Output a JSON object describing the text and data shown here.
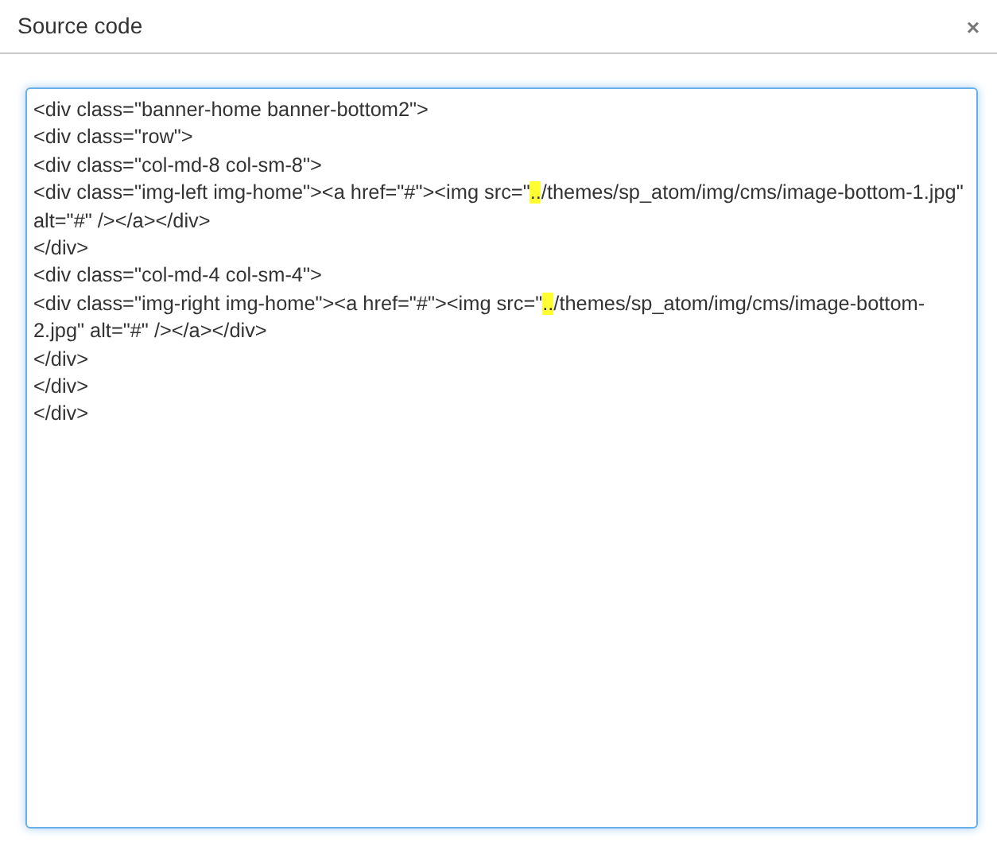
{
  "window": {
    "title": "Source code",
    "close": "×"
  },
  "editor": {
    "lines": [
      [
        {
          "text": "<div class=\"banner-home banner-bottom2\">",
          "highlighted": false
        }
      ],
      [
        {
          "text": "<div class=\"row\">",
          "highlighted": false
        }
      ],
      [
        {
          "text": "<div class=\"col-md-8 col-sm-8\">",
          "highlighted": false
        }
      ],
      [
        {
          "text": "<div class=\"img-left img-home\"><a href=\"#\"><img src=\"",
          "highlighted": false
        },
        {
          "text": "..",
          "highlighted": true
        },
        {
          "text": "/themes/sp_atom/img/cms/image-bottom-1.jpg\"",
          "highlighted": false
        }
      ],
      [
        {
          "text": "alt=\"#\" /></a></div>",
          "highlighted": false
        }
      ],
      [
        {
          "text": "</div>",
          "highlighted": false
        }
      ],
      [
        {
          "text": "<div class=\"col-md-4 col-sm-4\">",
          "highlighted": false
        }
      ],
      [
        {
          "text": "<div class=\"img-right img-home\"><a href=\"#\"><img src=\"",
          "highlighted": false
        },
        {
          "text": "..",
          "highlighted": true
        },
        {
          "text": "/themes/sp_atom/img/cms/image-bottom-",
          "highlighted": false
        }
      ],
      [
        {
          "text": "2.jpg\" alt=\"#\" /></a></div>",
          "highlighted": false
        }
      ],
      [
        {
          "text": "</div>",
          "highlighted": false
        }
      ],
      [
        {
          "text": "</div>",
          "highlighted": false
        }
      ],
      [
        {
          "text": "</div>",
          "highlighted": false
        }
      ]
    ]
  }
}
